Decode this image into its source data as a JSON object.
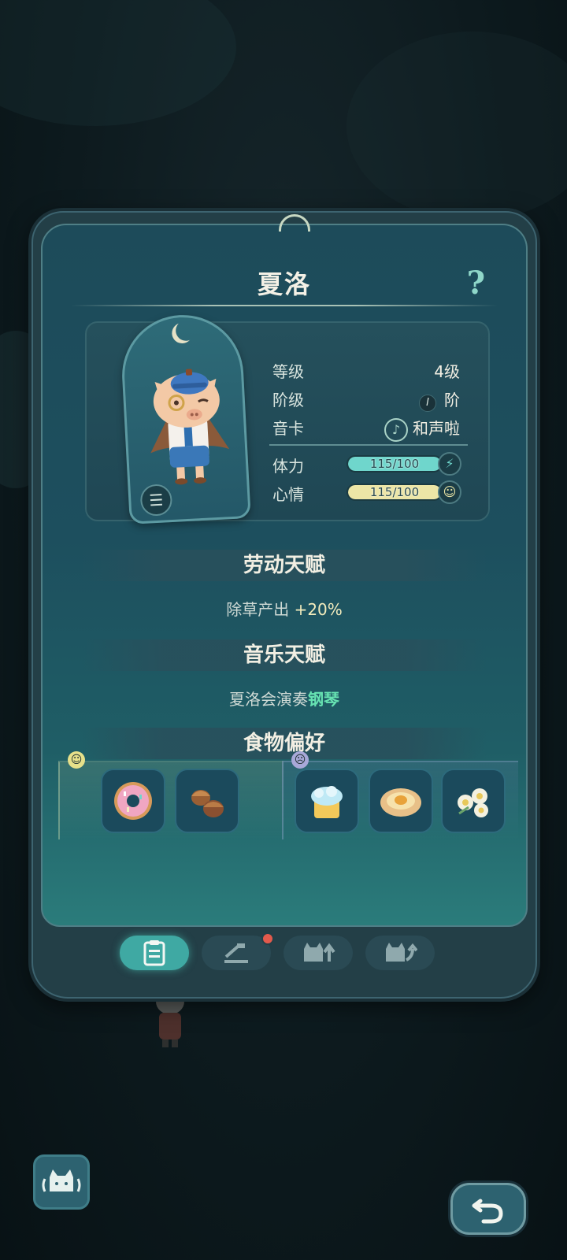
{
  "character": {
    "name": "夏洛",
    "stats": {
      "level_label": "等级",
      "level_value": "4级",
      "rank_label": "阶级",
      "rank_badge": "I",
      "rank_value": "阶",
      "card_label": "音卡",
      "card_value": "和声啦",
      "stamina_label": "体力",
      "stamina_text": "115/100",
      "stamina_fill": 1.0,
      "mood_label": "心情",
      "mood_text": "115/100",
      "mood_fill": 1.0
    }
  },
  "sections": {
    "labor": {
      "title": "劳动天赋",
      "text_prefix": "除草产出 ",
      "highlight": "+20%"
    },
    "music": {
      "title": "音乐天赋",
      "text_prefix": "夏洛会演奏",
      "highlight": "钢琴"
    },
    "food": {
      "title": "食物偏好"
    }
  },
  "food_preferences": {
    "liked": [
      "donut-icon",
      "acorn-icon"
    ],
    "disliked": [
      "cake-icon",
      "egg-tart-icon",
      "flowers-icon"
    ]
  },
  "tabs": [
    "profile-tab-icon",
    "tools-tab-icon",
    "upgrade-tab-icon",
    "promote-tab-icon"
  ],
  "colors": {
    "stamina_bar": "#6fd6cc",
    "mood_bar": "#ece6a6",
    "accent_green": "#67e3b2",
    "notification": "#e35a4c"
  }
}
